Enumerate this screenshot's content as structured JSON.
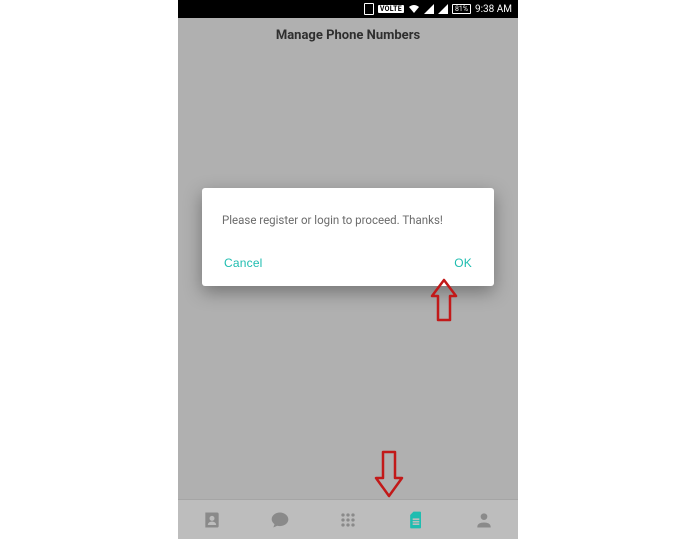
{
  "status_bar": {
    "volte_label": "VOLTE",
    "battery_label": "81%",
    "clock": "9:38 AM"
  },
  "header": {
    "title": "Manage Phone Numbers"
  },
  "dialog": {
    "message": "Please register or login to proceed. Thanks!",
    "cancel_label": "Cancel",
    "ok_label": "OK"
  },
  "nav": {
    "items": [
      {
        "name": "contacts",
        "active": false
      },
      {
        "name": "chat",
        "active": false
      },
      {
        "name": "dialpad",
        "active": false
      },
      {
        "name": "sim",
        "active": true
      },
      {
        "name": "profile",
        "active": false
      }
    ]
  },
  "colors": {
    "accent": "#1fbdb0",
    "annotation": "#c21919"
  }
}
